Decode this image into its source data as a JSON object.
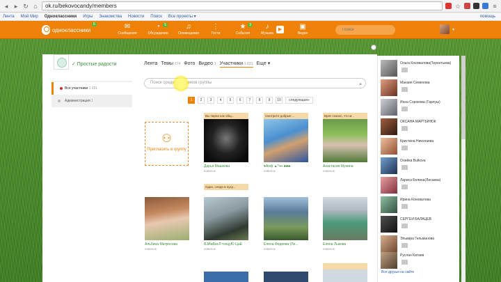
{
  "browser": {
    "url": "ok.ru/bekovocandy/members"
  },
  "bookmarks": {
    "items": [
      "Лента",
      "Мой Мир",
      "Одноклассники",
      "Игры",
      "Знакомства",
      "Новости",
      "Поиск",
      "Все проекты ▾"
    ],
    "right": "помощь"
  },
  "ok": {
    "logo_text": "одноклассники",
    "logo_badge": "6",
    "nav": [
      {
        "icon": "mail-icon",
        "glyph": "✉",
        "label": "Сообщения",
        "badge": ""
      },
      {
        "icon": "discussions-icon",
        "glyph": "💬",
        "label": "Обсуждения",
        "badge": "5"
      },
      {
        "icon": "bell-icon",
        "glyph": "🔔",
        "label": "Оповещения",
        "badge": ""
      },
      {
        "icon": "guests-icon",
        "glyph": "👣",
        "label": "Гости",
        "badge": ""
      },
      {
        "icon": "events-icon",
        "glyph": "★",
        "label": "События",
        "badge": "3"
      },
      {
        "icon": "music-icon",
        "glyph": "♪",
        "label": "Музыка",
        "badge": ""
      },
      {
        "icon": "video-icon",
        "glyph": "🎥",
        "label": "Видео",
        "badge": ""
      }
    ],
    "search_placeholder": "Поиск",
    "avatar_drop": "▾"
  },
  "group": {
    "name": "✓ Простые радости",
    "tabs": [
      {
        "label": "Лента",
        "count": ""
      },
      {
        "label": "Темы",
        "count": "674"
      },
      {
        "label": "Фото",
        "count": ""
      },
      {
        "label": "Видео",
        "count": "1"
      },
      {
        "label": "Участники",
        "count": "1 031"
      },
      {
        "label": "Еще ▾",
        "count": ""
      }
    ],
    "menu": [
      {
        "label": "Все участники",
        "count": "1 031"
      },
      {
        "label": "Администрация",
        "count": "1"
      }
    ],
    "search_placeholder": "Поиск среди участников группы",
    "pages": [
      "1",
      "2",
      "3",
      "4",
      "5",
      "6",
      "7",
      "8",
      "9",
      "10",
      "следующая»"
    ],
    "invite_label": "Пригласить в группу"
  },
  "members": [
    {
      "caption": "Вы парни как общ...",
      "name": "Дарья Машкова",
      "status": "новичок"
    },
    {
      "caption": "Смотрите добрые ...",
      "name": "♥Анф ▲^▪▪▪ ♣♣♣",
      "status": "новичок"
    },
    {
      "caption": "Врач сказал, что м...",
      "name": "Анастасия Мунина",
      "status": "новичок"
    },
    {
      "caption": "",
      "name": "Альбина Матросова",
      "status": "новичок"
    },
    {
      "caption": "Один, следя в пуху...",
      "name": "ВЈЙжБисЛ тэхцуЮ ЦаЕ",
      "status": "новичок"
    },
    {
      "caption": "",
      "name": "Елена Федеева (Ле...",
      "status": "новичок"
    },
    {
      "caption": "",
      "name": "Елена Лыкова",
      "status": "новичок"
    }
  ],
  "friends": [
    "Ольга Коновалова(Терентьева)",
    "Манзия Семенова",
    "Инна Сорокова (Гарлуш)",
    "ОКСАНА МАРТЫНЮК",
    "Кристина Николаева",
    "Олейка Bulkova",
    "Лариса Белина(Лисаева)",
    "Ирина Коновалова",
    "СЕРГЕЙ БАЛАЦЕВ",
    "Эльвира Гельманова",
    "Руслан Катаев"
  ],
  "friends_all": "Все друзья на сайте"
}
